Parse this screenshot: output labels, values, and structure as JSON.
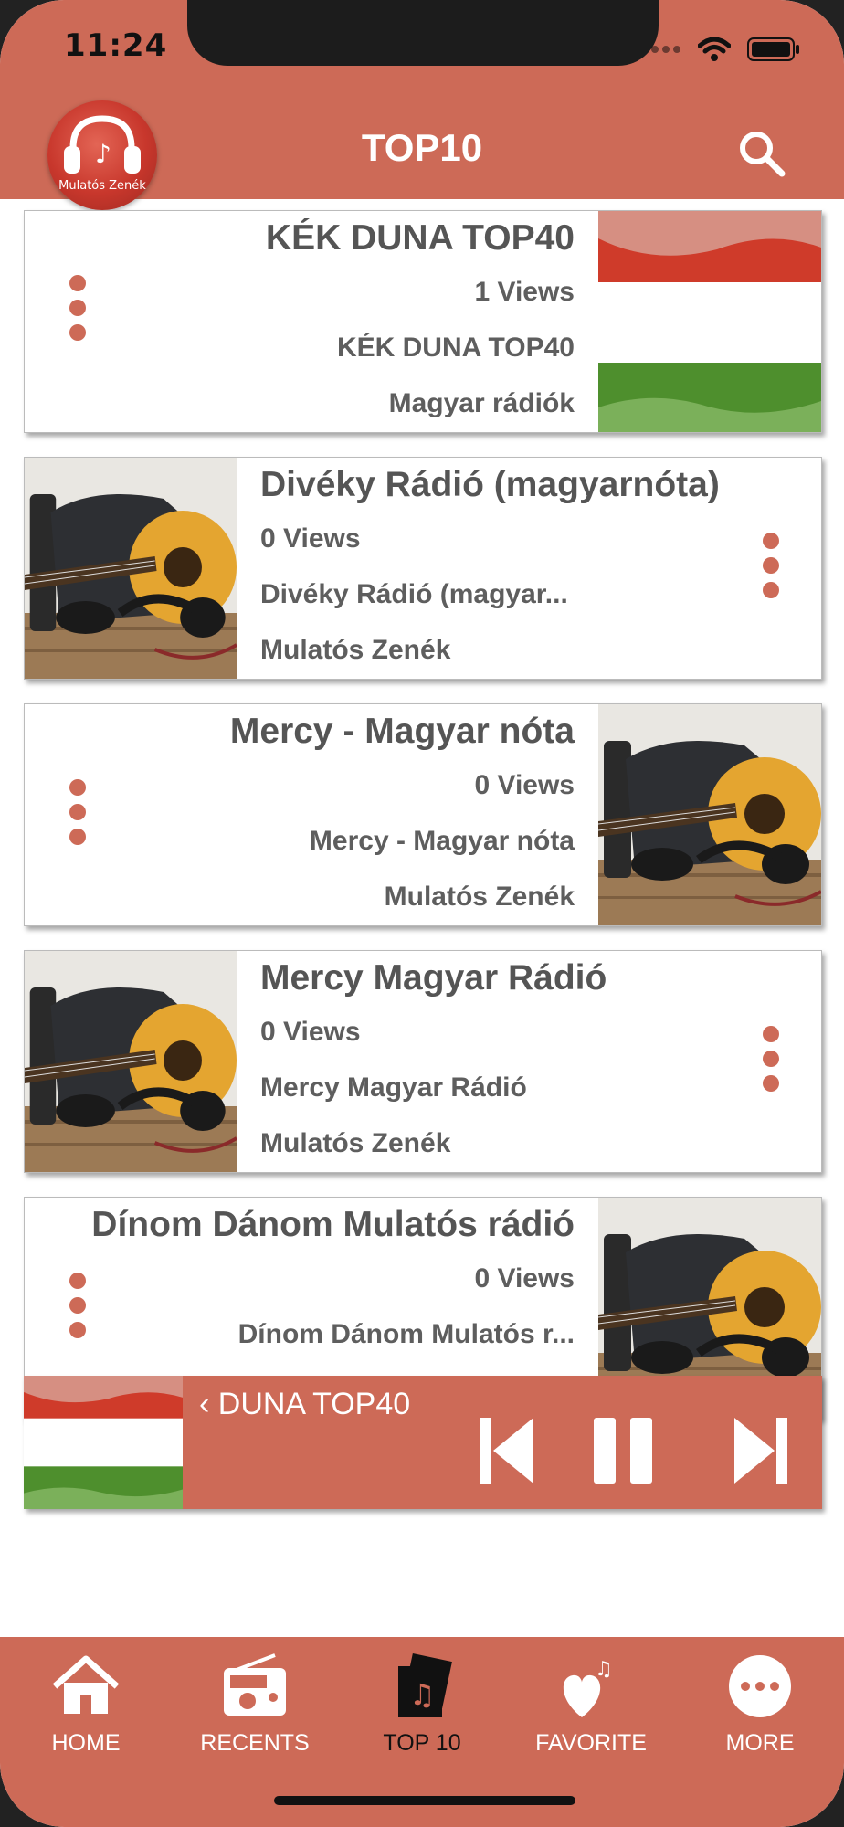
{
  "status_bar": {
    "time": "11:24"
  },
  "header": {
    "title": "TOP10",
    "logo_text": "Mulatós Zenék"
  },
  "cards": [
    {
      "title": "KÉK DUNA TOP40",
      "views": "1 Views",
      "subtitle": "KÉK DUNA TOP40",
      "category": "Magyar rádiók",
      "thumbnail": "hungary-flag",
      "layout": "thumb-right"
    },
    {
      "title": "Divéky Rádió (magyarnóta)",
      "views": "0 Views",
      "subtitle": "Divéky Rádió (magyar...",
      "category": "Mulatós Zenék",
      "thumbnail": "guitar-photo",
      "layout": "thumb-left"
    },
    {
      "title": "Mercy - Magyar nóta",
      "views": "0 Views",
      "subtitle": "Mercy - Magyar nóta",
      "category": "Mulatós Zenék",
      "thumbnail": "guitar-photo",
      "layout": "thumb-right"
    },
    {
      "title": "Mercy Magyar Rádió",
      "views": "0 Views",
      "subtitle": "Mercy Magyar Rádió",
      "category": "Mulatós Zenék",
      "thumbnail": "guitar-photo",
      "layout": "thumb-left"
    },
    {
      "title": "Dínom Dánom Mulatós rádió",
      "views": "0 Views",
      "subtitle": "Dínom Dánom Mulatós r...",
      "thumbnail": "guitar-photo",
      "layout": "thumb-right"
    }
  ],
  "player": {
    "title": "‹ DUNA TOP40",
    "thumbnail": "hungary-flag",
    "controls": [
      "skip-back-icon",
      "pause-icon",
      "skip-forward-icon"
    ]
  },
  "tabs": [
    {
      "label": "HOME",
      "icon": "home-icon",
      "active": false
    },
    {
      "label": "RECENTS",
      "icon": "radio-icon",
      "active": false
    },
    {
      "label": "TOP 10",
      "icon": "album-music-icon",
      "active": true
    },
    {
      "label": "FAVORITE",
      "icon": "heart-music-icon",
      "active": false
    },
    {
      "label": "MORE",
      "icon": "more-dots-icon",
      "active": false
    }
  ],
  "colors": {
    "accent": "#cd6a57",
    "text": "#5a5a5a",
    "active_tab_text": "#111111"
  }
}
